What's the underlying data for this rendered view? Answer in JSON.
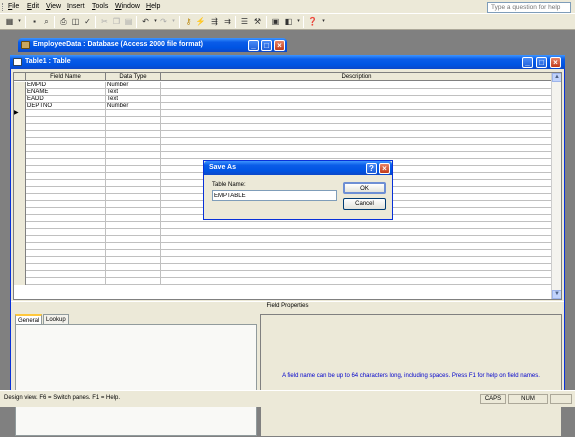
{
  "menubar": {
    "items": [
      "File",
      "Edit",
      "View",
      "Insert",
      "Tools",
      "Window",
      "Help"
    ],
    "help_placeholder": "Type a question for help"
  },
  "toolbar": {
    "icons": [
      "view-icon",
      "save-icon",
      "search-icon",
      "print-icon",
      "print-preview-icon",
      "spelling-icon",
      "cut-icon",
      "copy-icon",
      "paste-icon",
      "undo-icon",
      "redo-icon",
      "primary-key-icon",
      "indexes-icon",
      "insert-rows-icon",
      "delete-rows-icon",
      "properties-icon",
      "build-icon",
      "database-window-icon",
      "new-object-icon",
      "help-icon"
    ]
  },
  "db_window": {
    "title": "EmployeeData : Database (Access 2000 file format)"
  },
  "table_window": {
    "title": "Table1 : Table",
    "columns": [
      "Field Name",
      "Data Type",
      "Description"
    ],
    "rows": [
      {
        "field": "EMPID",
        "type": "Number",
        "description": ""
      },
      {
        "field": "ENAME",
        "type": "Text",
        "description": ""
      },
      {
        "field": "EADD",
        "type": "Text",
        "description": ""
      },
      {
        "field": "DEPTNO",
        "type": "Number",
        "description": ""
      }
    ],
    "current_row_marker": "▶",
    "field_properties_label": "Field Properties",
    "tabs": [
      "General",
      "Lookup"
    ],
    "help_text": "A field name can be up to 64 characters long, including spaces.  Press F1 for help on field names."
  },
  "dialog": {
    "title": "Save As",
    "label": "Table Name:",
    "value": "EMPTABLE",
    "ok": "OK",
    "cancel": "Cancel"
  },
  "statusbar": {
    "text": "Design view.  F6 = Switch panes.  F1 = Help.",
    "caps": "CAPS",
    "num": "NUM"
  }
}
